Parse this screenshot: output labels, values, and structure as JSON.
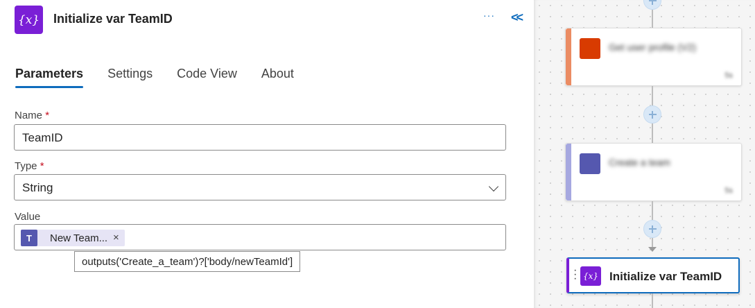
{
  "header": {
    "icon_glyph": "{x}",
    "icon_name": "variable-icon",
    "title": "Initialize var TeamID",
    "more_label": "···",
    "collapse_label": "<<"
  },
  "tabs": [
    {
      "label": "Parameters",
      "active": true
    },
    {
      "label": "Settings",
      "active": false
    },
    {
      "label": "Code View",
      "active": false
    },
    {
      "label": "About",
      "active": false
    }
  ],
  "form": {
    "name_label": "Name",
    "name_value": "TeamID",
    "type_label": "Type",
    "type_value": "String",
    "value_label": "Value",
    "required_mark": "*",
    "token": {
      "icon_name": "teams-icon",
      "icon_glyph": "T",
      "label": "New Team...",
      "remove_label": "×"
    },
    "tooltip": "outputs('Create_a_team')?['body/newTeamId']"
  },
  "canvas": {
    "cards": [
      {
        "title": "Get user profile (V2)",
        "footer": "5s",
        "accent": "#eb8c63",
        "icon_color": "#d83b01"
      },
      {
        "title": "Create a team",
        "footer": "5s",
        "accent": "#a6a8e0",
        "icon_color": "#5558af"
      }
    ],
    "selected_card": {
      "icon_glyph": "{x}",
      "title": "Initialize var TeamID",
      "accent": "#7a1fd6"
    }
  },
  "colors": {
    "brand_purple": "#7a1fd6",
    "link_blue": "#0f6cbd",
    "teams_purple": "#5558af"
  }
}
